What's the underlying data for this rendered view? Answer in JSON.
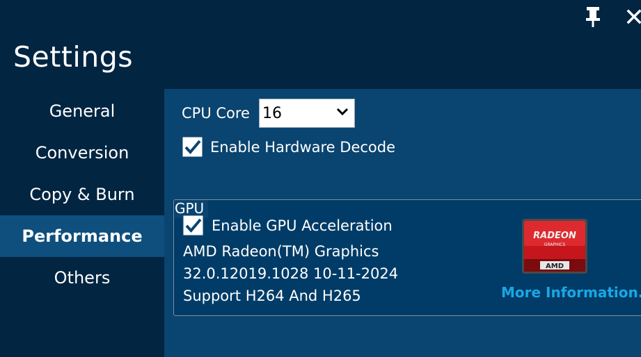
{
  "window": {
    "title": "Settings",
    "pin_icon": "pin-icon",
    "close_icon": "close-icon"
  },
  "nav": {
    "items": [
      {
        "label": "General",
        "active": false
      },
      {
        "label": "Conversion",
        "active": false
      },
      {
        "label": "Copy & Burn",
        "active": false
      },
      {
        "label": "Performance",
        "active": true
      },
      {
        "label": "Others",
        "active": false
      }
    ]
  },
  "performance": {
    "cpu_core_label": "CPU Core",
    "cpu_core_value": "16",
    "hw_decode_label": "Enable Hardware Decode",
    "hw_decode_checked": true,
    "gpu": {
      "legend": "GPU",
      "accel_label": "Enable GPU Acceleration",
      "accel_checked": true,
      "name": "AMD Radeon(TM) Graphics",
      "driver": "32.0.12019.1028 10-11-2024",
      "support": "Support H264 And H265",
      "more_info": "More Information...",
      "logo_text": "RADEON",
      "logo_sub": "GRAPHICS",
      "logo_brand": "AMD"
    }
  },
  "colors": {
    "background": "#022541",
    "content_bg": "#0a4470",
    "nav_active": "#0f4f7d",
    "link": "#1aa7e6",
    "logo_red": "#c4161c"
  }
}
